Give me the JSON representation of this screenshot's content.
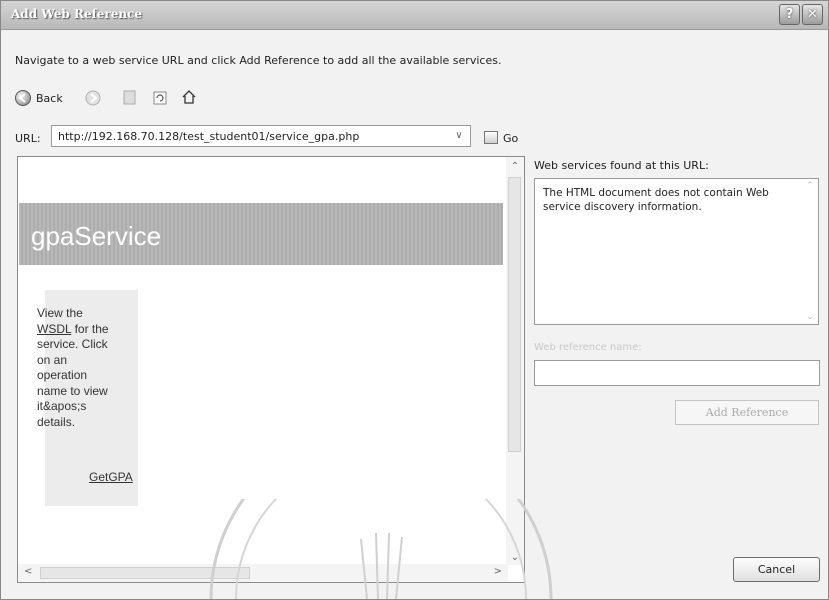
{
  "window": {
    "title": "Add Web Reference",
    "help_glyph": "?",
    "close_glyph": "✕"
  },
  "instruction": "Navigate to a web service URL and click Add Reference to add all the available services.",
  "toolbar": {
    "back_label": "Back",
    "icons": [
      "back-arrow-icon",
      "forward-arrow-icon",
      "stop-icon",
      "refresh-icon",
      "home-icon"
    ]
  },
  "url_bar": {
    "label": "URL:",
    "value": "http://192.168.70.128/test_student01/service_gpa.php",
    "go_label": "Go"
  },
  "browser": {
    "service_title": "gpaService",
    "sidebar_lines": [
      "View the"
    ],
    "wsdl_link": "WSDL",
    "after_link": " for the service. Click on an operation name to view it&apos;s details.",
    "operation_link": "GetGPA"
  },
  "services_panel": {
    "label": "Web services found at this URL:",
    "message": "The HTML document does not contain Web service discovery information."
  },
  "reference": {
    "name_label": "Web reference name:",
    "name_value": "",
    "add_button": "Add Reference"
  },
  "cancel_button": "Cancel"
}
